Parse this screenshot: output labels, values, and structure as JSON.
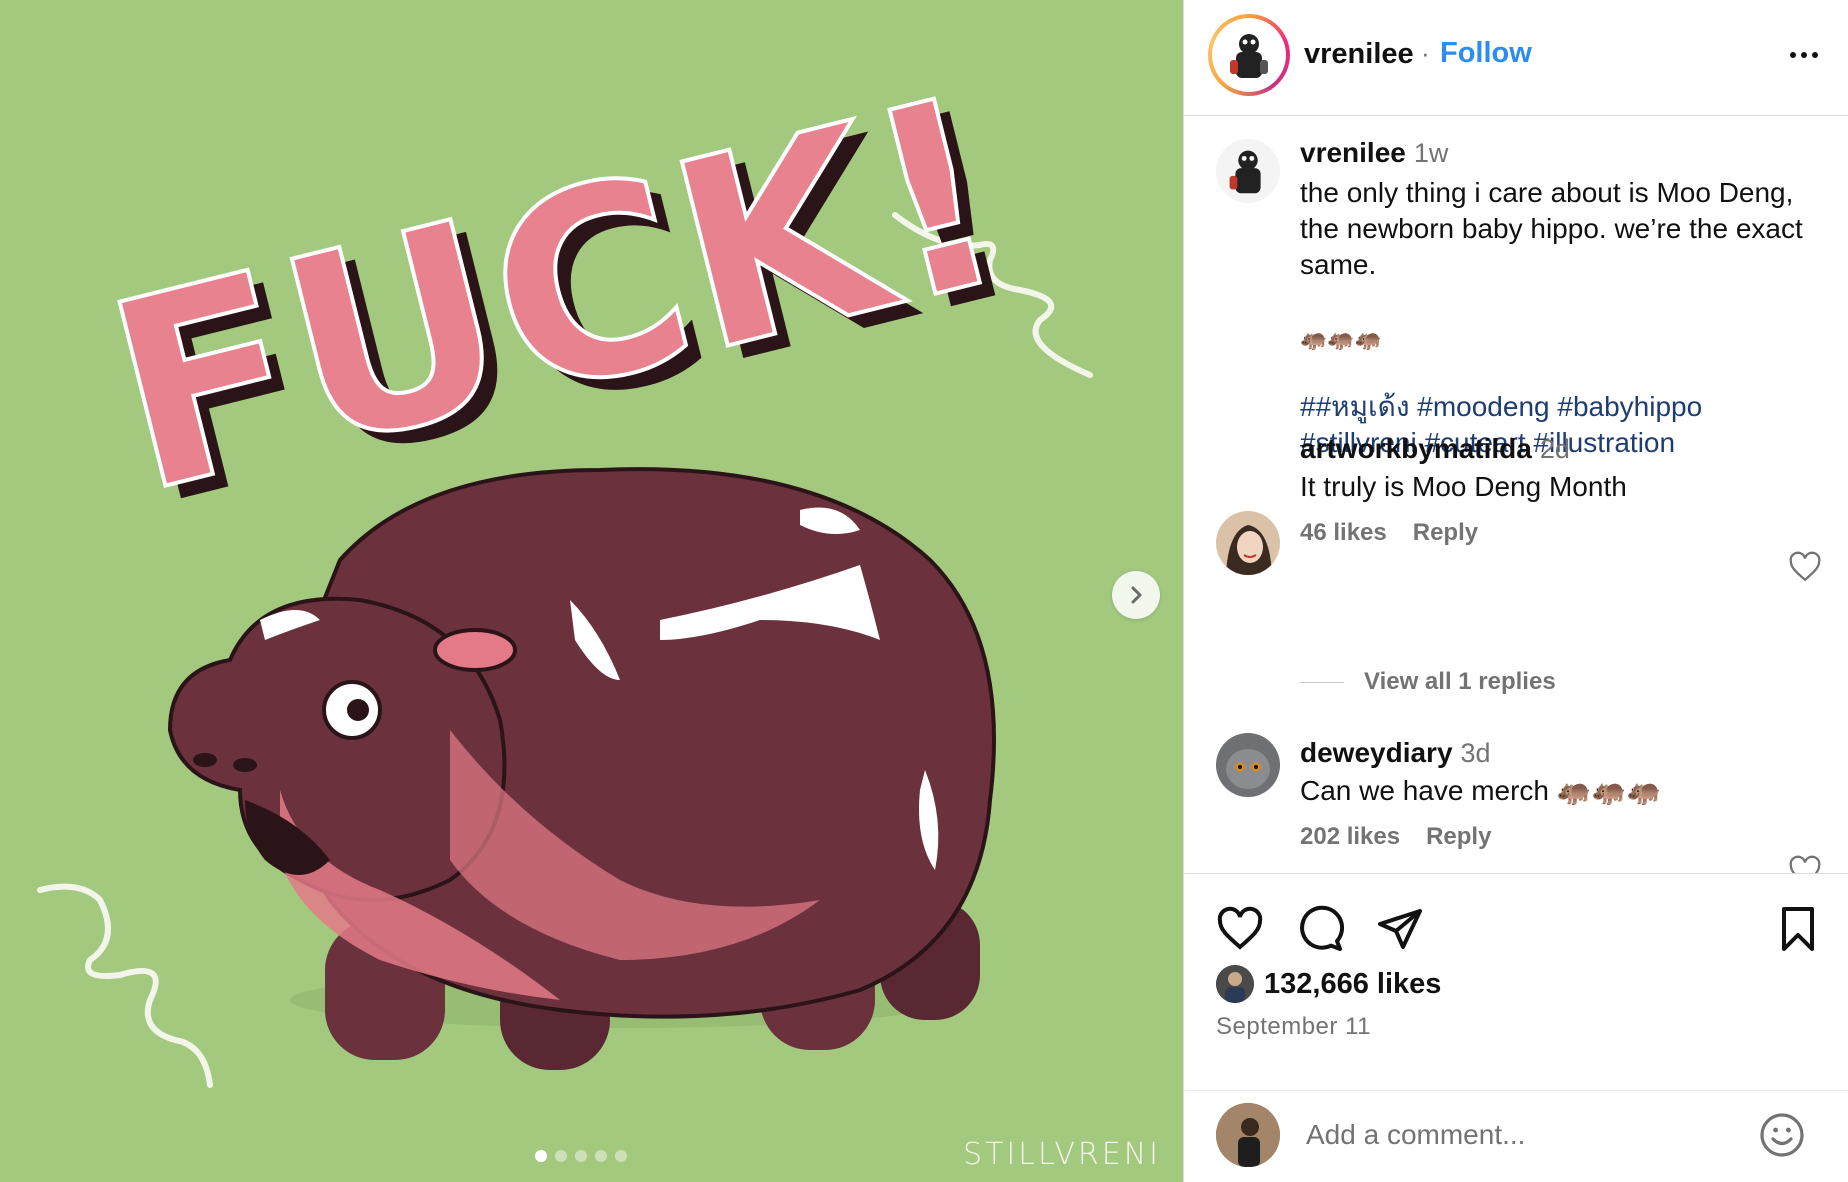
{
  "post": {
    "username": "vrenilee",
    "follow_label": "Follow",
    "separator": "·"
  },
  "caption": {
    "username": "vrenilee",
    "time": "1w",
    "text": "the only thing i care about is Moo Deng, the newborn baby hippo. we’re the exact same.",
    "emojis": "🦛🦛🦛",
    "hashtags_line1": "##หมูเด้ง #moodeng #babyhippo",
    "hashtags_line2": "#stillvreni #cuteart #illustration"
  },
  "comments": [
    {
      "username": "artworkbymatilda",
      "time": "2d",
      "text": "It truly is Moo Deng Month",
      "likes": "46 likes",
      "reply_label": "Reply",
      "view_replies": "View all 1 replies"
    },
    {
      "username": "deweydiary",
      "time": "3d",
      "text": "Can we have merch 🦛🦛🦛",
      "likes": "202 likes",
      "reply_label": "Reply"
    }
  ],
  "stats": {
    "likes": "132,666 likes",
    "date": "September 11"
  },
  "comment_box": {
    "placeholder": "Add a comment..."
  },
  "media": {
    "art_text": "FUCK!",
    "watermark": "STILLVRENI",
    "slide_count": 5,
    "active_slide": 1
  },
  "icons": {
    "like": "heart-icon",
    "comment": "comment-bubble-icon",
    "share": "paper-plane-icon",
    "save": "bookmark-icon",
    "more": "more-dots-icon",
    "next": "chevron-right-icon",
    "emoji": "smiley-icon"
  },
  "colors": {
    "follow_blue": "#2d8cf0",
    "hashtag_blue": "#1d3d73",
    "media_bg": "#a3c97f",
    "hippo": "#6b323e",
    "pink": "#e47a87"
  }
}
